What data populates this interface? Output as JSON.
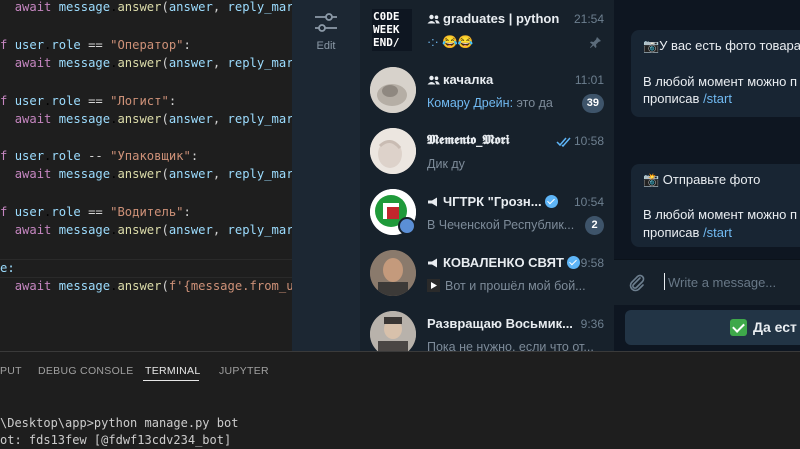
{
  "editor": {
    "lines": [
      {
        "indent": "  ",
        "kw": "await",
        "obj": "message",
        "fn": "answer",
        "arg1": "answer",
        "arg2": "reply_mar"
      },
      {
        "kw": "f",
        "var": "user",
        "attr": "role",
        "op": "==",
        "str": "\"Оператор\"",
        "colon": ":"
      },
      {
        "indent": "  ",
        "kw": "await",
        "obj": "message",
        "fn": "answer",
        "arg1": "answer",
        "arg2": "reply_mar"
      },
      {
        "kw": "f",
        "var": "user",
        "attr": "role",
        "op": "==",
        "str": "\"Логист\"",
        "colon": ":"
      },
      {
        "indent": "  ",
        "kw": "await",
        "obj": "message",
        "fn": "answer",
        "arg1": "answer",
        "arg2": "reply_mar"
      },
      {
        "kw": "f",
        "var": "user",
        "attr": "role",
        "op": "--",
        "str": "\"Упаковщик\"",
        "colon": ":"
      },
      {
        "indent": "  ",
        "kw": "await",
        "obj": "message",
        "fn": "answer",
        "arg1": "answer",
        "arg2": "reply_mar"
      },
      {
        "kw": "f",
        "var": "user",
        "attr": "role",
        "op": "==",
        "str": "\"Водитель\"",
        "colon": ":"
      },
      {
        "indent": "  ",
        "kw": "await",
        "obj": "message",
        "fn": "answer",
        "arg1": "answer",
        "arg2": "reply_mar"
      },
      {
        "kw": "e:"
      },
      {
        "indent": "  ",
        "kw": "await",
        "obj": "message",
        "fn": "answer",
        "fstr": "f'{message.from_u"
      }
    ]
  },
  "panel": {
    "tabs": [
      "PUT",
      "DEBUG CONSOLE",
      "TERMINAL",
      "JUPYTER"
    ],
    "active_tab": "TERMINAL",
    "terminal_lines": [
      "\\Desktop\\app>python manage.py bot",
      "ot: fds13few [@fdwf13cdv234_bot]"
    ]
  },
  "telegram": {
    "rail": {
      "edit_label": "Edit"
    },
    "chats": [
      {
        "title": "graduates | python",
        "time": "21:54",
        "preview": "·:· 😂😂",
        "group": true,
        "pinned": true,
        "avatar_text": "C0DE WEEK END/"
      },
      {
        "title": "качалка",
        "time": "11:01",
        "sender": "Комару Дрейн:",
        "preview": " это да",
        "group": true,
        "badge": "39"
      },
      {
        "title": "𝕸𝖊𝖒𝖊𝖓𝖙𝖔_𝕸𝖔𝖗𝖎",
        "time": "10:58",
        "preview": "Дик ду",
        "read": true
      },
      {
        "title": "ЧГТРК \"Грозн...",
        "time": "10:54",
        "preview": "В Чеченской Республик...",
        "channel": true,
        "verified": true,
        "badge": "2"
      },
      {
        "title": "КОВАЛЕНКО СВЯТ",
        "time": "9:58",
        "preview": "Вот и прошёл мой бой...",
        "channel": true,
        "verified": true,
        "video": true
      },
      {
        "title": "Развращаю Восьмик...",
        "time": "9:36",
        "preview": "Пока не нужно, если что от..."
      }
    ],
    "messages": [
      {
        "lines": [
          "📷У вас есть фото товара",
          "",
          "В любой момент можно п",
          "прописав "
        ],
        "link": "/start"
      },
      {
        "lines": [
          "📸 Отправьте фото",
          "",
          "В любой момент можно п",
          "прописав "
        ],
        "link": "/start"
      }
    ],
    "compose": {
      "placeholder": "Write a message..."
    },
    "reply_button": {
      "label": "Да ест"
    },
    "colors": {
      "accent": "#71baf2",
      "list_bg": "#17212b",
      "chat_bg": "#0e1621",
      "rail_bg": "#1c2733",
      "badge": "#3e546a",
      "verified": "#5eb5f7"
    }
  }
}
